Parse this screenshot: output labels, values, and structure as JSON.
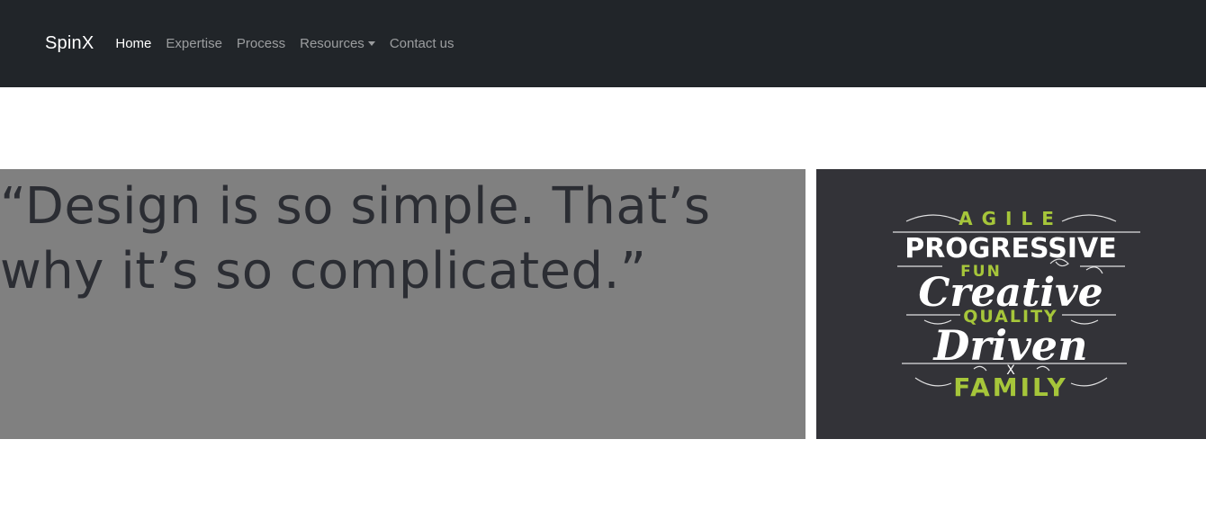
{
  "navbar": {
    "brand": "SpinX",
    "links": [
      {
        "label": "Home",
        "active": true
      },
      {
        "label": "Expertise",
        "active": false
      },
      {
        "label": "Process",
        "active": false
      },
      {
        "label": "Resources",
        "active": false,
        "dropdown": true
      },
      {
        "label": "Contact us",
        "active": false
      }
    ]
  },
  "hero": {
    "quote": "“Design is so simple. That’s why it’s so complicated.”"
  },
  "poster": {
    "line1": "AGILE",
    "line2": "PROGRESSIVE",
    "line3": "FUN",
    "line4": "Creative",
    "line5": "QUALITY",
    "line6": "Driven",
    "line7": "X",
    "line8": "FAMILY",
    "colors": {
      "background": "#333338",
      "white": "#ffffff",
      "accent": "#a6c63a"
    }
  }
}
